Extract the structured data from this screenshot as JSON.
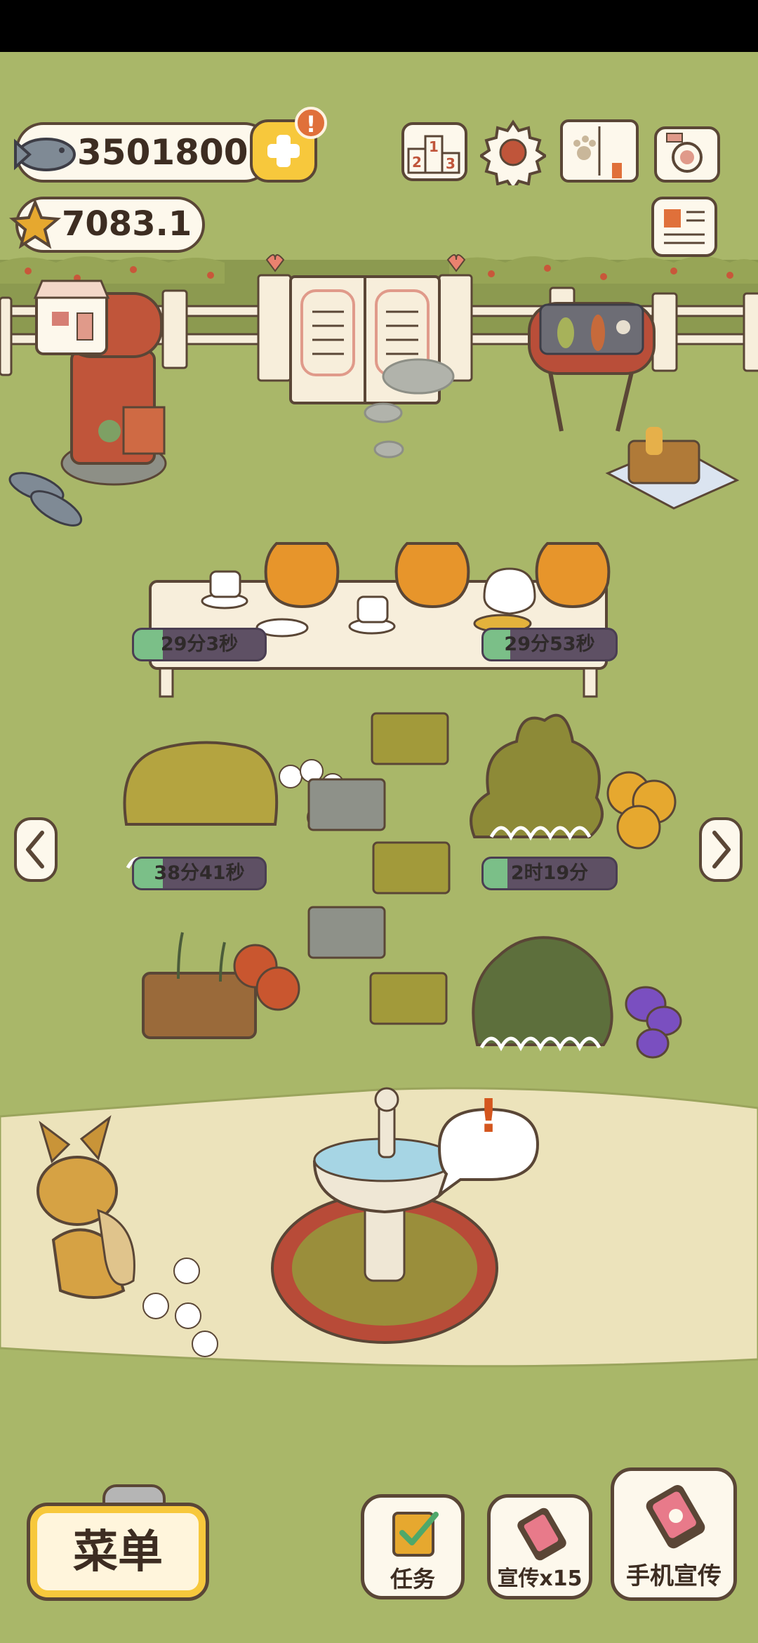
{
  "currency": {
    "fish": "3501800",
    "stars": "7083.1",
    "notification": "!"
  },
  "timers": [
    {
      "label": "29分3秒",
      "progress": 0.22
    },
    {
      "label": "29分53秒",
      "progress": 0.2
    },
    {
      "label": "38分41秒",
      "progress": 0.22
    },
    {
      "label": "2时19分",
      "progress": 0.18
    }
  ],
  "fountain_alert": "!",
  "bottom": {
    "menu_label": "菜单",
    "tasks_label": "任务",
    "promo_label": "宣传x15",
    "phone_promo_label": "手机宣传"
  },
  "icons": {
    "fish": "fish-icon",
    "star": "star-icon",
    "plus": "plus-icon",
    "ranking": "ranking-icon",
    "settings": "gear-icon",
    "album": "paw-book-icon",
    "camera": "camera-icon",
    "newspaper": "newspaper-icon",
    "shop": "shop-icon"
  },
  "colors": {
    "grass": "#a9b769",
    "path": "#ece3bb",
    "outline": "#5a4636",
    "accent": "#f7c83c",
    "timer_fill": "#7bbf88",
    "timer_bg": "#5e5064"
  }
}
